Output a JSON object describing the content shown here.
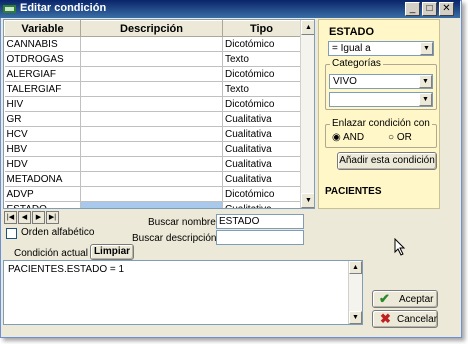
{
  "window": {
    "title": "Editar condición"
  },
  "titlebar_buttons": {
    "minimize": "_",
    "maximize": "□",
    "close": "✕"
  },
  "grid": {
    "columns": [
      "Variable",
      "Descripción",
      "Tipo"
    ],
    "rows": [
      {
        "variable": "CANNABIS",
        "descripcion": "",
        "tipo": "Dicotómico"
      },
      {
        "variable": "OTDROGAS",
        "descripcion": "",
        "tipo": "Texto"
      },
      {
        "variable": "ALERGIAF",
        "descripcion": "",
        "tipo": "Dicotómico"
      },
      {
        "variable": "TALERGIAF",
        "descripcion": "",
        "tipo": "Texto"
      },
      {
        "variable": "HIV",
        "descripcion": "",
        "tipo": "Dicotómico"
      },
      {
        "variable": "GR",
        "descripcion": "",
        "tipo": "Cualitativa"
      },
      {
        "variable": "HCV",
        "descripcion": "",
        "tipo": "Cualitativa"
      },
      {
        "variable": "HBV",
        "descripcion": "",
        "tipo": "Cualitativa"
      },
      {
        "variable": "HDV",
        "descripcion": "",
        "tipo": "Cualitativa"
      },
      {
        "variable": "METADONA",
        "descripcion": "",
        "tipo": "Cualitativa"
      },
      {
        "variable": "ADVP",
        "descripcion": "",
        "tipo": "Dicotómico"
      },
      {
        "variable": "ESTADO",
        "descripcion": "",
        "tipo": "Cualitativa"
      },
      {
        "variable": "ESTADO",
        "descripcion": "",
        "tipo": "Cualitativa"
      }
    ],
    "selected_row": 11,
    "scroll_up": "▲",
    "scroll_down": "▼"
  },
  "panel": {
    "field_name": "ESTADO",
    "operator": "= Igual a",
    "categorias_label": "Categorías",
    "category_value": "VIVO",
    "category_value_2": "",
    "enlazar_label": "Enlazar condición con",
    "and_label": "AND",
    "or_label": "OR",
    "link_selected": "AND",
    "add_button": "Añadir esta condición",
    "table_name": "PACIENTES",
    "colors": {
      "background": "#fff7c8"
    }
  },
  "nav": {
    "first": "|◀",
    "prev": "◀",
    "next": "▶",
    "last": "▶|"
  },
  "options": {
    "orden_alfabetico_label": "Orden alfabético",
    "orden_alfabetico_checked": false
  },
  "search": {
    "nombre_label": "Buscar nombre",
    "nombre_value": "ESTADO",
    "descripcion_label": "Buscar descripción",
    "descripcion_value": ""
  },
  "condition": {
    "tab_label": "Condición actual",
    "clear_button": "Limpiar",
    "text": "PACIENTES.ESTADO = 1"
  },
  "actions": {
    "accept_label": "Aceptar",
    "cancel_label": "Cancelar",
    "accept_color": "#2a8a2a",
    "cancel_color": "#c02020"
  }
}
